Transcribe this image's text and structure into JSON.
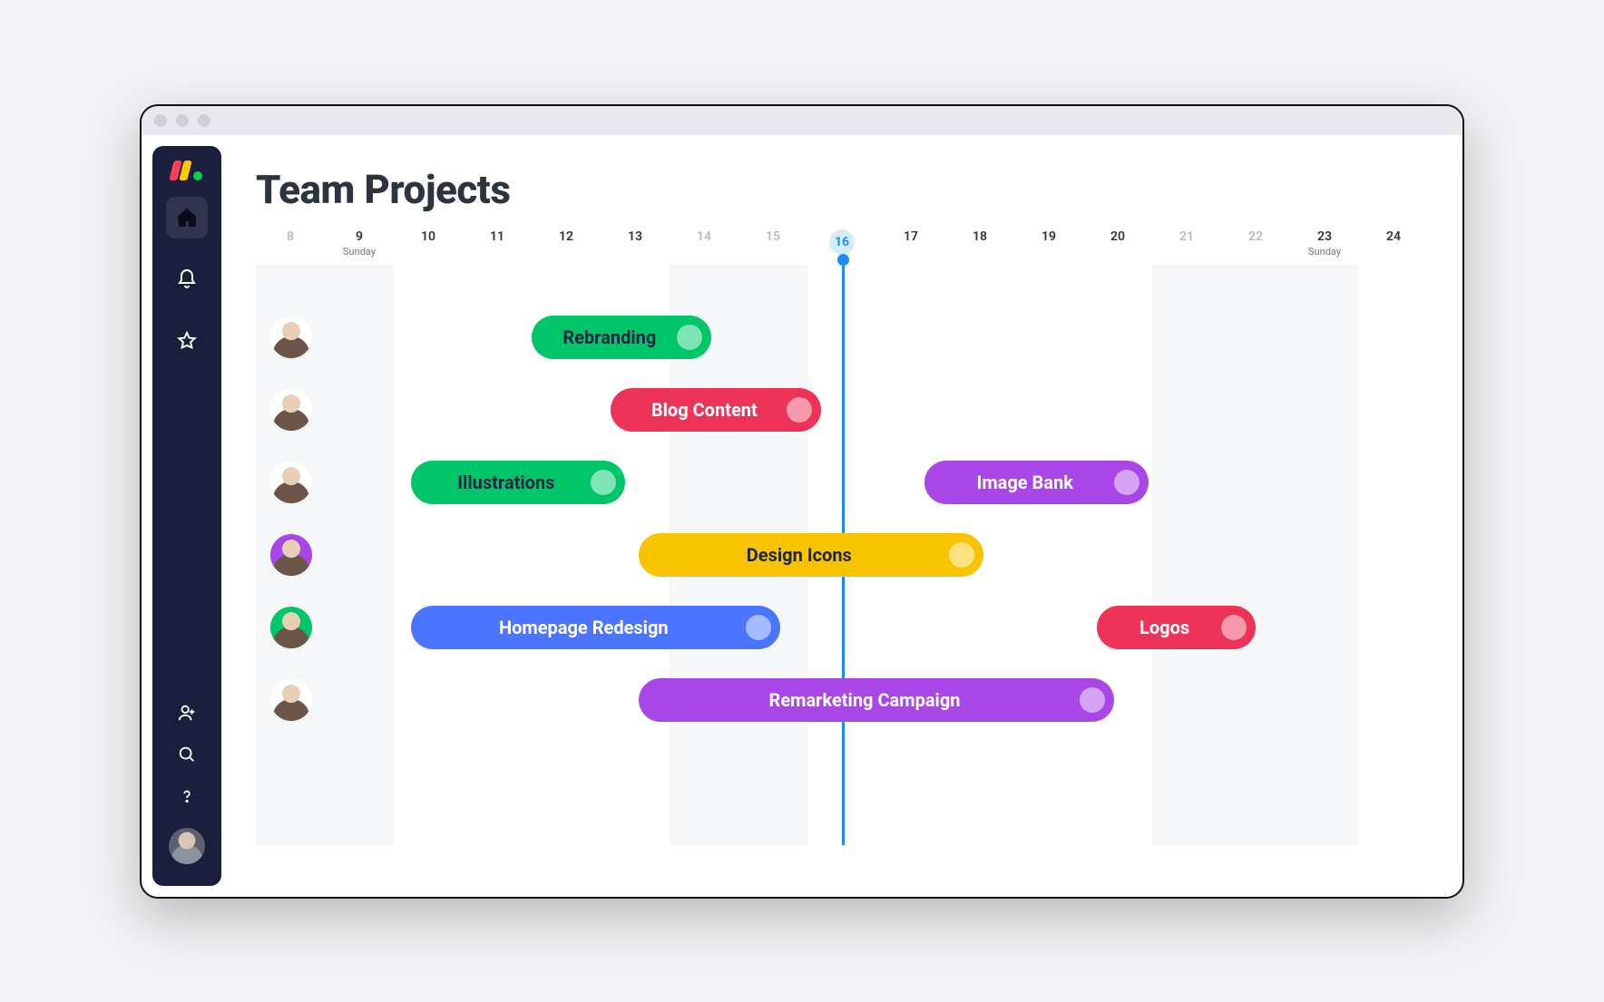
{
  "header": {
    "title": "Team Projects"
  },
  "days": [
    {
      "num": "8",
      "muted": true
    },
    {
      "num": "9",
      "sub": "Sunday"
    },
    {
      "num": "10"
    },
    {
      "num": "11"
    },
    {
      "num": "12"
    },
    {
      "num": "13"
    },
    {
      "num": "14",
      "muted": true
    },
    {
      "num": "15",
      "muted": true
    },
    {
      "num": "16",
      "today": true
    },
    {
      "num": "17"
    },
    {
      "num": "18"
    },
    {
      "num": "19"
    },
    {
      "num": "20"
    },
    {
      "num": "21",
      "muted": true
    },
    {
      "num": "22",
      "muted": true
    },
    {
      "num": "23",
      "sub": "Sunday"
    },
    {
      "num": "24"
    }
  ],
  "colors": {
    "green": "#00c66a",
    "red": "#ee3358",
    "yellow": "#f8c300",
    "blue": "#4b74ff",
    "purple": "#a946e8",
    "accent": "#1a8cff",
    "sidebar": "#1b1e3c"
  },
  "rows": [
    {
      "avatar_bg": "#ffffff",
      "tasks": [
        {
          "label": "Rebranding",
          "color": "green",
          "start": 4,
          "span": 2.6,
          "dark": true
        }
      ]
    },
    {
      "avatar_bg": "#ffffff",
      "tasks": [
        {
          "label": "Blog Content",
          "color": "red",
          "start": 5.15,
          "span": 3.05
        }
      ]
    },
    {
      "avatar_bg": "#ffffff",
      "tasks": [
        {
          "label": "Illustrations",
          "color": "green",
          "start": 2.25,
          "span": 3.1,
          "dark": true
        },
        {
          "label": "Image Bank",
          "color": "purple",
          "start": 9.7,
          "span": 3.25
        }
      ]
    },
    {
      "avatar_bg": "#a946e8",
      "tasks": [
        {
          "label": "Design Icons",
          "color": "yellow",
          "start": 5.55,
          "span": 5.0,
          "dark": true
        }
      ]
    },
    {
      "avatar_bg": "#00c66a",
      "tasks": [
        {
          "label": "Homepage Redesign",
          "color": "blue",
          "start": 2.25,
          "span": 5.35
        },
        {
          "label": "Logos",
          "color": "red",
          "start": 12.2,
          "span": 2.3
        }
      ]
    },
    {
      "avatar_bg": "#ffffff",
      "tasks": [
        {
          "label": "Remarketing Campaign",
          "color": "purple",
          "start": 5.55,
          "span": 6.9
        }
      ]
    }
  ],
  "sidebar": {
    "icons": [
      "home",
      "bell",
      "star"
    ],
    "bottom_icons": [
      "add-user",
      "search",
      "help"
    ]
  }
}
